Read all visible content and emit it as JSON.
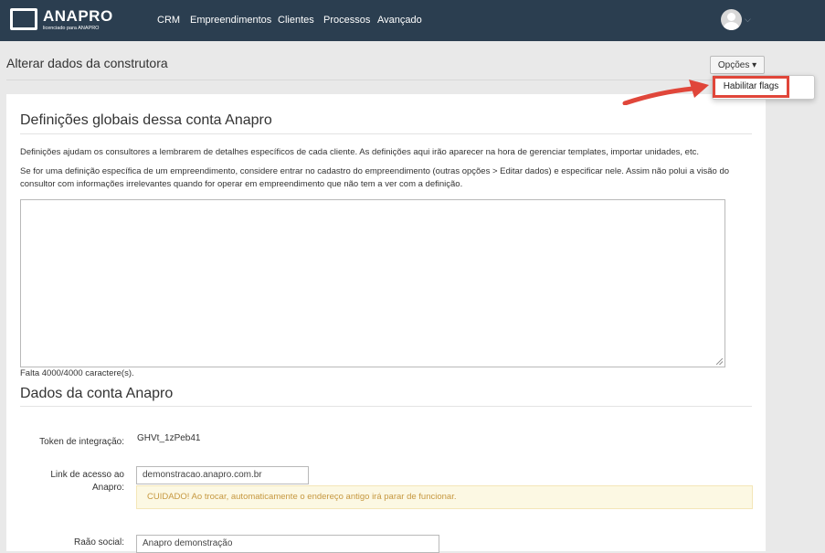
{
  "navbar": {
    "logo_text": "ANAPRO",
    "logo_sub": "licenciado para ANAPRO",
    "links": [
      "CRM",
      "Empreendimentos",
      "Clientes",
      "Processos",
      "Avançado"
    ]
  },
  "header": {
    "title": "Alterar dados da construtora",
    "options_label": "Opções ▾",
    "dropdown_item": "Habilitar flags"
  },
  "globals": {
    "title": "Definições globais dessa conta Anapro",
    "para1": "Definições ajudam os consultores a lembrarem de detalhes específicos de cada cliente. As definições aqui irão aparecer na hora de gerenciar templates, importar unidades, etc.",
    "para2": "Se for uma definição específica de um empreendimento, considere entrar no cadastro do empreendimento (outras opções > Editar dados) e especificar nele. Assim não polui a visão do consultor com informações irrelevantes quando for operar em empreendimento que não tem a ver com a definição.",
    "textarea_value": "",
    "counter": "Falta 4000/4000 caractere(s)."
  },
  "account": {
    "title": "Dados da conta Anapro",
    "token_label": "Token de integração:",
    "token_value": "GHVt_1zPeb41",
    "link_label_line1": "Link de acesso ao",
    "link_label_line2": "Anapro:",
    "link_value": "demonstracao.anapro.com.br",
    "warning": "CUIDADO! Ao trocar, automaticamente o endereço antigo irá parar de funcionar.",
    "next_label_partial": "Raão social:",
    "next_value_partial": "Anapro demonstração"
  },
  "colors": {
    "navbar": "#2b3e50",
    "highlight": "#e0463a",
    "warning_bg": "#fcf8e3",
    "warning_text": "#c69840"
  }
}
